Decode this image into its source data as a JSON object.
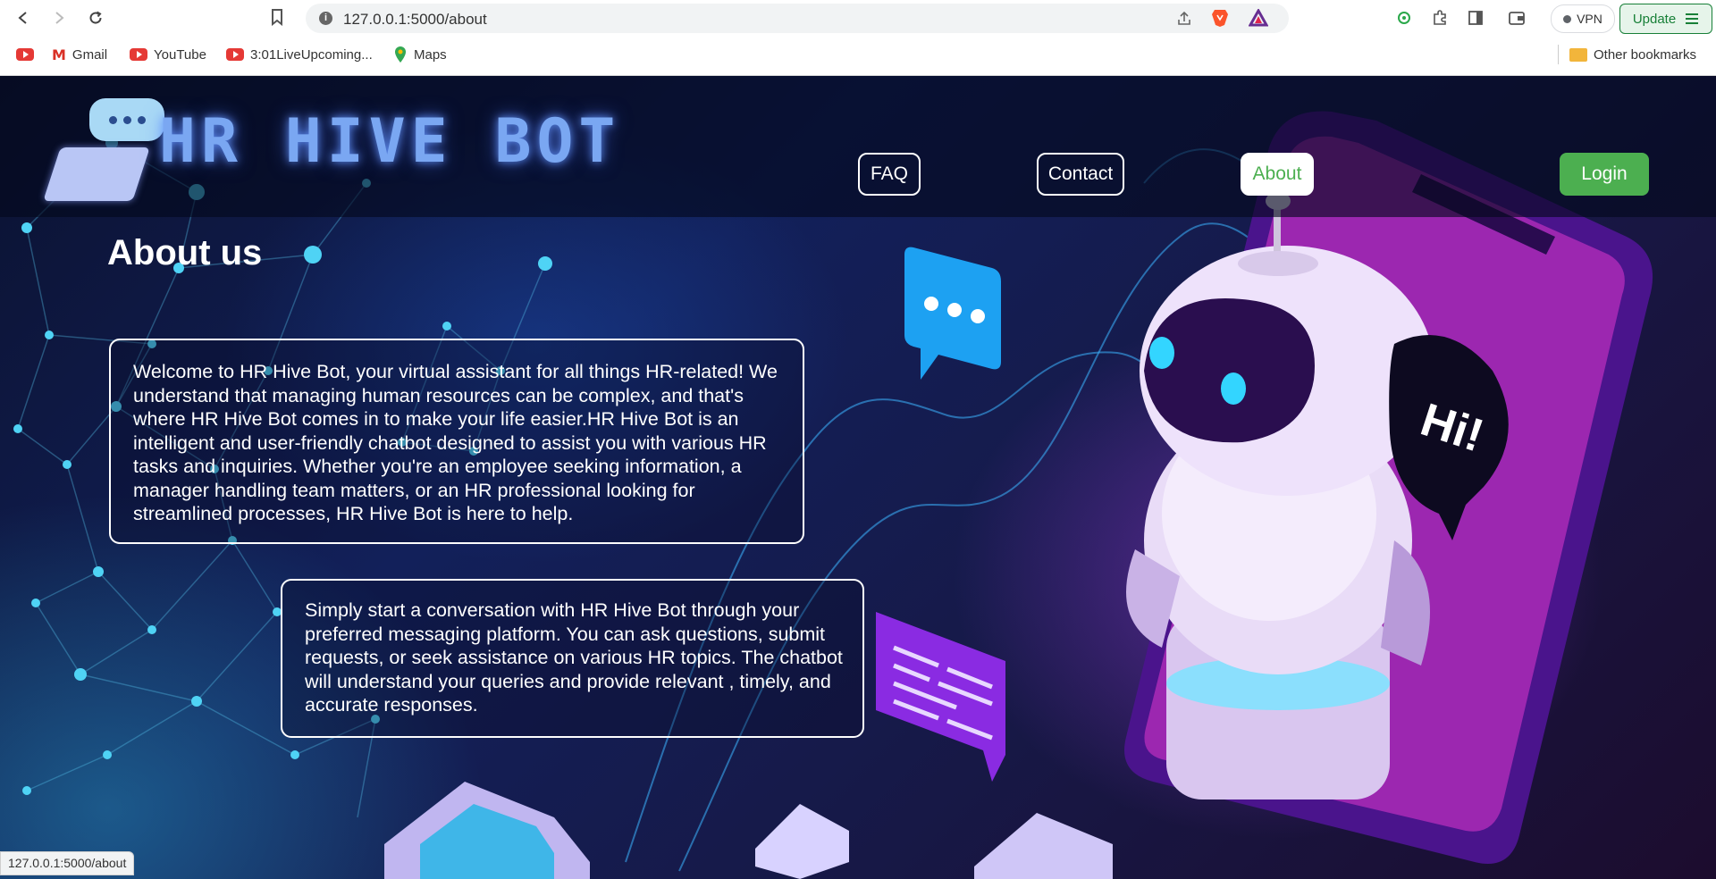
{
  "browser": {
    "url": "127.0.0.1:5000/about",
    "bookmarks": [
      "Gmail",
      "YouTube",
      "3:01LiveUpcoming...",
      "Maps"
    ],
    "other_bookmarks": "Other bookmarks",
    "vpn_label": "VPN",
    "update_label": "Update"
  },
  "site": {
    "logo_text": "HR HIVE BOT",
    "nav": {
      "faq": "FAQ",
      "contact": "Contact",
      "about": "About",
      "login": "Login"
    }
  },
  "about": {
    "title": "About us",
    "paragraphs": [
      "Welcome to HR Hive Bot, your virtual assistant for all things HR-related! We understand that managing human resources can be complex, and that's where HR Hive Bot comes in to make your life easier.HR Hive Bot is an intelligent and user-friendly chatbot designed to assist you with various HR tasks and inquiries. Whether you're an employee seeking information, a manager handling team matters, or an HR professional looking for streamlined processes, HR Hive Bot is here to help.",
      "Simply start a conversation with HR Hive Bot through your preferred messaging platform. You can ask questions, submit requests, or seek assistance on various HR topics. The chatbot will understand your queries and provide relevant , timely, and accurate responses."
    ]
  },
  "hero": {
    "speech_text": "Hi!"
  },
  "status_bar": "127.0.0.1:5000/about",
  "colors": {
    "accent_green": "#4caf50",
    "logo_blue": "#7aa7f2"
  }
}
